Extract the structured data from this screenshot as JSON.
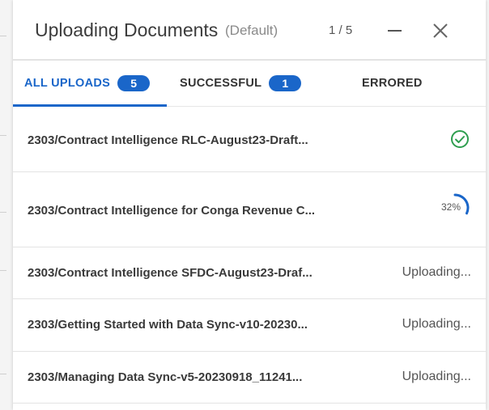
{
  "dialog": {
    "title": "Uploading Documents",
    "subtitle": "(Default)",
    "counter": "1 / 5"
  },
  "tabs": [
    {
      "label": "ALL UPLOADS",
      "count": "5"
    },
    {
      "label": "SUCCESSFUL",
      "count": "1"
    },
    {
      "label": "ERRORED"
    }
  ],
  "uploads": [
    {
      "name": "2303/Contract Intelligence RLC-August23-Draft...",
      "state": "success",
      "icon": "check-circle-icon"
    },
    {
      "name": "2303/Contract Intelligence for Conga Revenue C...",
      "state": "in-progress",
      "progress": 32,
      "progress_label": "32%"
    },
    {
      "name": "2303/Contract Intelligence SFDC-August23-Draf...",
      "state": "uploading",
      "status": "Uploading..."
    },
    {
      "name": "2303/Getting Started with Data Sync-v10-20230...",
      "state": "uploading",
      "status": "Uploading..."
    },
    {
      "name": "2303/Managing Data Sync-v5-20230918_11241...",
      "state": "uploading",
      "status": "Uploading..."
    }
  ],
  "colors": {
    "accent": "#1a66c9",
    "success": "#2e9e4f"
  }
}
